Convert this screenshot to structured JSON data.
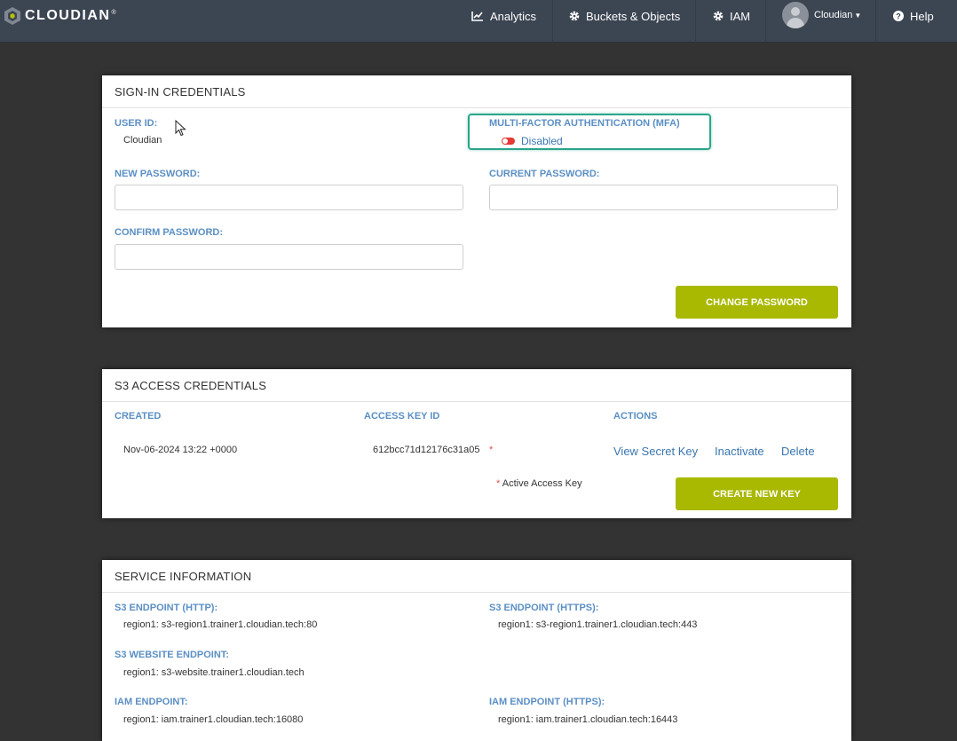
{
  "nav": {
    "brand": "CLOUDIAN",
    "brand_mark": "®",
    "analytics": "Analytics",
    "buckets": "Buckets & Objects",
    "iam": "IAM",
    "user": "Cloudian",
    "help": "Help"
  },
  "signin": {
    "title": "SIGN-IN CREDENTIALS",
    "user_id_label": "USER ID:",
    "user_id_value": "Cloudian",
    "mfa_label": "MULTI-FACTOR AUTHENTICATION (MFA)",
    "mfa_status": "Disabled",
    "new_password_label": "NEW PASSWORD:",
    "current_password_label": "CURRENT PASSWORD:",
    "confirm_password_label": "CONFIRM PASSWORD:",
    "new_password_value": "",
    "current_password_value": "",
    "confirm_password_value": "",
    "change_password_button": "CHANGE PASSWORD"
  },
  "s3": {
    "title": "S3 ACCESS CREDENTIALS",
    "col_created": "CREATED",
    "col_key": "ACCESS KEY ID",
    "col_actions": "ACTIONS",
    "row": {
      "created": "Nov-06-2024 13:22 +0000",
      "key": "612bcc71d12176c31a05",
      "marker": "*",
      "view": "View Secret Key",
      "inactivate": "Inactivate",
      "delete": "Delete"
    },
    "note_star": "*",
    "note": "Active Access Key",
    "create_button": "CREATE NEW KEY"
  },
  "service": {
    "title": "SERVICE INFORMATION",
    "http_label": "S3 ENDPOINT (HTTP):",
    "http_value": "region1:  s3-region1.trainer1.cloudian.tech:80",
    "https_label": "S3 ENDPOINT (HTTPS):",
    "https_value": "region1:  s3-region1.trainer1.cloudian.tech:443",
    "website_label": "S3 WEBSITE ENDPOINT:",
    "website_value": "region1:  s3-website.trainer1.cloudian.tech",
    "iam_label": "IAM ENDPOINT:",
    "iam_value": "region1:  iam.trainer1.cloudian.tech:16080",
    "iam_https_label": "IAM ENDPOINT (HTTPS):",
    "iam_https_value": "region1:  iam.trainer1.cloudian.tech:16443"
  },
  "colors": {
    "accent_button": "#a9b800",
    "label_blue": "#5b8fc4",
    "link_blue": "#3a76b0",
    "mfa_highlight": "#2aa58a",
    "toggle_off": "#e53935"
  }
}
